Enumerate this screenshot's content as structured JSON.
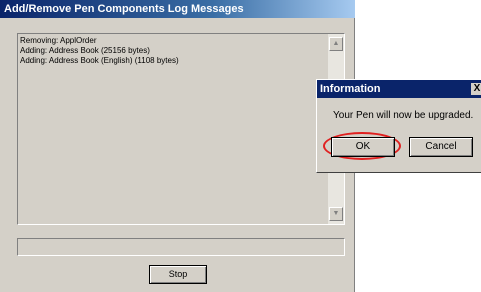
{
  "main_window": {
    "title": "Add/Remove Pen Components Log Messages",
    "log_lines": [
      "Removing: ApplOrder",
      "Adding: Address Book (25156 bytes)",
      "Adding: Address Book (English) (1108 bytes)"
    ],
    "progress_fraction": 0,
    "stop_label": "Stop"
  },
  "info_dialog": {
    "title": "Information",
    "close_glyph": "X",
    "message": "Your Pen will now be upgraded.",
    "ok_label": "OK",
    "cancel_label": "Cancel"
  },
  "scrollbar": {
    "up_glyph": "▲",
    "down_glyph": "▼"
  },
  "colors": {
    "titlebar": "#0a246a",
    "window_face": "#d4d0c8",
    "highlight_ring": "#e02020"
  }
}
